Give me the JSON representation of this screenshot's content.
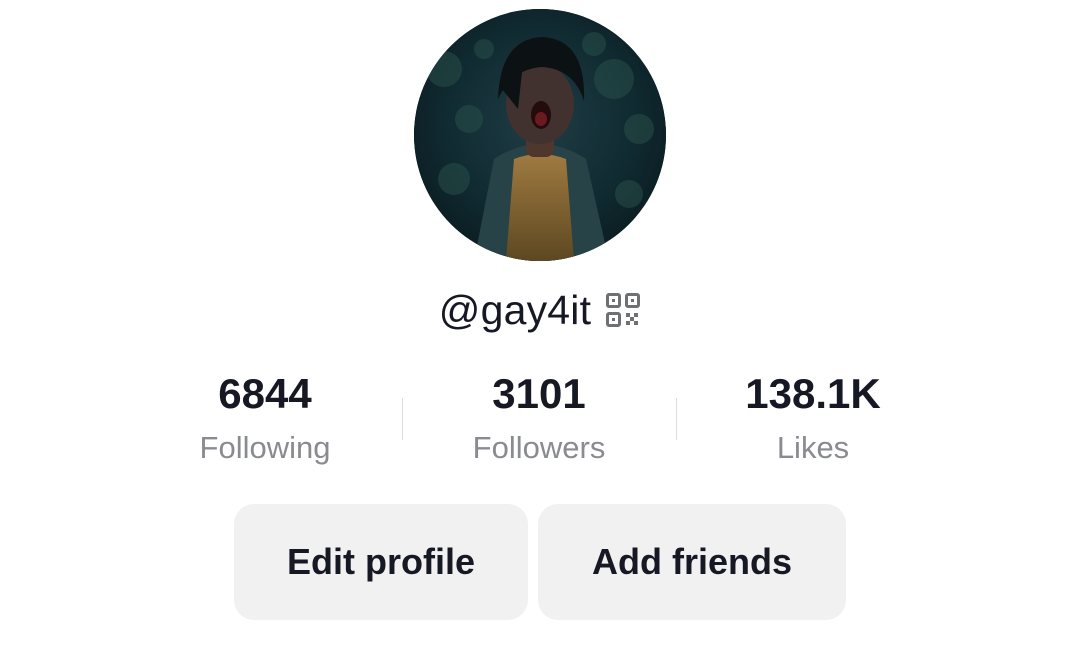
{
  "profile": {
    "username": "@gay4it",
    "stats": [
      {
        "value": "6844",
        "label": "Following"
      },
      {
        "value": "3101",
        "label": "Followers"
      },
      {
        "value": "138.1K",
        "label": "Likes"
      }
    ],
    "buttons": {
      "edit_profile": "Edit profile",
      "add_friends": "Add friends"
    }
  },
  "icons": {
    "qr": "qr-code-icon"
  },
  "colors": {
    "text_primary": "#161823",
    "text_secondary": "#8a8b91",
    "button_bg": "#f1f1f2",
    "divider": "#dcdde0"
  }
}
